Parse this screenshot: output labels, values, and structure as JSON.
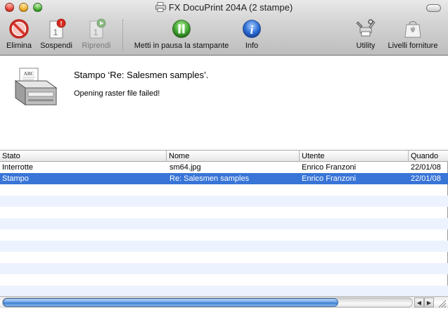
{
  "window": {
    "title": "FX DocuPrint 204A (2 stampe)"
  },
  "toolbar": {
    "items": [
      {
        "label": "Elimina",
        "icon": "delete-icon",
        "enabled": true
      },
      {
        "label": "Sospendi",
        "icon": "hold-icon",
        "enabled": true
      },
      {
        "label": "Riprendi",
        "icon": "resume-icon",
        "enabled": false
      },
      {
        "label": "Metti in pausa la stampante",
        "icon": "pause-icon",
        "enabled": true
      },
      {
        "label": "Info",
        "icon": "info-icon",
        "enabled": true
      },
      {
        "label": "Utility",
        "icon": "utility-icon",
        "enabled": true
      },
      {
        "label": "Livelli forniture",
        "icon": "supply-levels-icon",
        "enabled": true
      }
    ],
    "badge_text": "1"
  },
  "status": {
    "title": "Stampo ‘Re: Salesmen samples’.",
    "message": "Opening raster file failed!",
    "printer_paper_text": "ABC"
  },
  "table": {
    "columns": [
      "Stato",
      "Nome",
      "Utente",
      "Quando"
    ],
    "rows": [
      {
        "stato": "Interrotte",
        "nome": "sm64.jpg",
        "utente": "Enrico Franzoni",
        "quando": "22/01/08",
        "selected": false
      },
      {
        "stato": "Stampo",
        "nome": "Re: Salesmen samples",
        "utente": "Enrico Franzoni",
        "quando": "22/01/08",
        "selected": true
      }
    ]
  },
  "scrollbar": {
    "left_arrow": "◀",
    "right_arrow": "▶"
  },
  "colors": {
    "selection": "#3875d7",
    "alt_row": "#edf3fe",
    "delete_red": "#d8342a",
    "pause_green": "#46a936",
    "info_blue": "#2f6fd6"
  }
}
